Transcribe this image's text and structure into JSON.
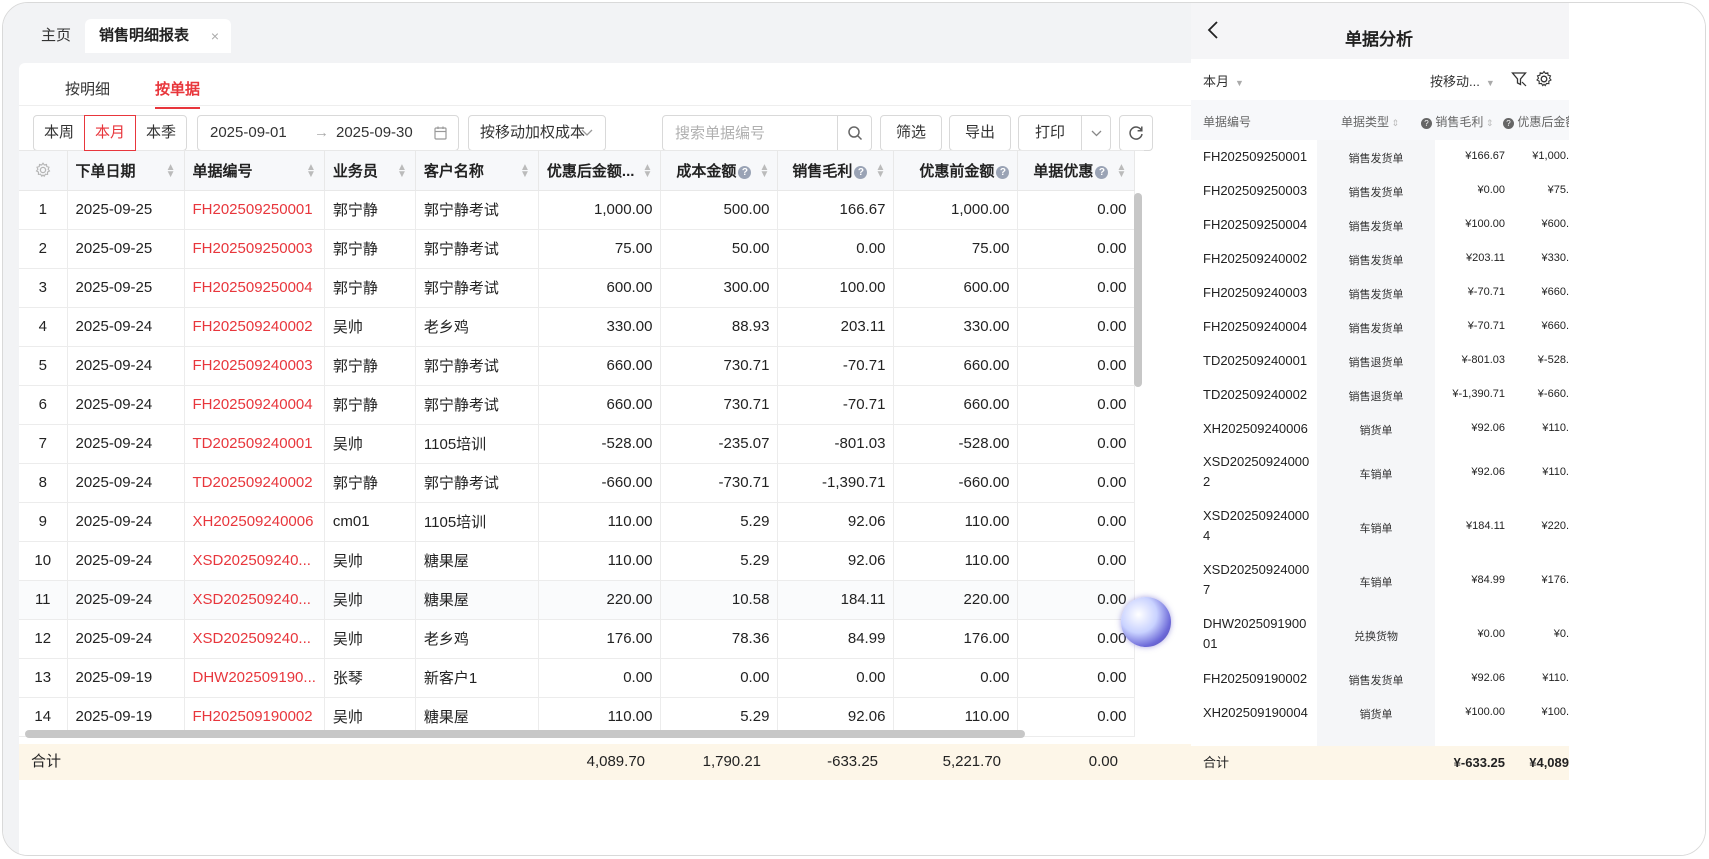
{
  "tabs": {
    "home": "主页",
    "active": "销售明细报表",
    "close": "×"
  },
  "subtabs": {
    "detail": "按明细",
    "document": "按单据"
  },
  "period": {
    "week": "本周",
    "month": "本月",
    "quarter": "本季"
  },
  "daterange": {
    "start": "2025-09-01",
    "arrow": "→",
    "end": "2025-09-30"
  },
  "cost_method": {
    "label": "按移动加权成本"
  },
  "search": {
    "placeholder": "搜索单据编号"
  },
  "buttons": {
    "filter": "筛选",
    "export": "导出",
    "print": "打印"
  },
  "table": {
    "headers": {
      "date": "下单日期",
      "docno": "单据编号",
      "salesman": "业务员",
      "customer": "客户名称",
      "after_discount": "优惠后金额...",
      "cost": "成本金额",
      "gross_profit": "销售毛利",
      "before_discount": "优惠前金额",
      "doc_discount": "单据优惠"
    },
    "rows": [
      {
        "idx": "1",
        "date": "2025-09-25",
        "docno": "FH202509250001",
        "salesman": "郭宁静",
        "customer": "郭宁静考试",
        "after": "1,000.00",
        "cost": "500.00",
        "profit": "166.67",
        "before": "1,000.00",
        "disc": "0.00"
      },
      {
        "idx": "2",
        "date": "2025-09-25",
        "docno": "FH202509250003",
        "salesman": "郭宁静",
        "customer": "郭宁静考试",
        "after": "75.00",
        "cost": "50.00",
        "profit": "0.00",
        "before": "75.00",
        "disc": "0.00"
      },
      {
        "idx": "3",
        "date": "2025-09-25",
        "docno": "FH202509250004",
        "salesman": "郭宁静",
        "customer": "郭宁静考试",
        "after": "600.00",
        "cost": "300.00",
        "profit": "100.00",
        "before": "600.00",
        "disc": "0.00"
      },
      {
        "idx": "4",
        "date": "2025-09-24",
        "docno": "FH202509240002",
        "salesman": "吴帅",
        "customer": "老乡鸡",
        "after": "330.00",
        "cost": "88.93",
        "profit": "203.11",
        "before": "330.00",
        "disc": "0.00"
      },
      {
        "idx": "5",
        "date": "2025-09-24",
        "docno": "FH202509240003",
        "salesman": "郭宁静",
        "customer": "郭宁静考试",
        "after": "660.00",
        "cost": "730.71",
        "profit": "-70.71",
        "before": "660.00",
        "disc": "0.00"
      },
      {
        "idx": "6",
        "date": "2025-09-24",
        "docno": "FH202509240004",
        "salesman": "郭宁静",
        "customer": "郭宁静考试",
        "after": "660.00",
        "cost": "730.71",
        "profit": "-70.71",
        "before": "660.00",
        "disc": "0.00"
      },
      {
        "idx": "7",
        "date": "2025-09-24",
        "docno": "TD202509240001",
        "salesman": "吴帅",
        "customer": "1105培训",
        "after": "-528.00",
        "cost": "-235.07",
        "profit": "-801.03",
        "before": "-528.00",
        "disc": "0.00"
      },
      {
        "idx": "8",
        "date": "2025-09-24",
        "docno": "TD202509240002",
        "salesman": "郭宁静",
        "customer": "郭宁静考试",
        "after": "-660.00",
        "cost": "-730.71",
        "profit": "-1,390.71",
        "before": "-660.00",
        "disc": "0.00"
      },
      {
        "idx": "9",
        "date": "2025-09-24",
        "docno": "XH202509240006",
        "salesman": "cm01",
        "customer": "1105培训",
        "after": "110.00",
        "cost": "5.29",
        "profit": "92.06",
        "before": "110.00",
        "disc": "0.00"
      },
      {
        "idx": "10",
        "date": "2025-09-24",
        "docno": "XSD202509240...",
        "salesman": "吴帅",
        "customer": "糖果屋",
        "after": "110.00",
        "cost": "5.29",
        "profit": "92.06",
        "before": "110.00",
        "disc": "0.00"
      },
      {
        "idx": "11",
        "date": "2025-09-24",
        "docno": "XSD202509240...",
        "salesman": "吴帅",
        "customer": "糖果屋",
        "after": "220.00",
        "cost": "10.58",
        "profit": "184.11",
        "before": "220.00",
        "disc": "0.00"
      },
      {
        "idx": "12",
        "date": "2025-09-24",
        "docno": "XSD202509240...",
        "salesman": "吴帅",
        "customer": "老乡鸡",
        "after": "176.00",
        "cost": "78.36",
        "profit": "84.99",
        "before": "176.00",
        "disc": "0.00"
      },
      {
        "idx": "13",
        "date": "2025-09-19",
        "docno": "DHW202509190...",
        "salesman": "张琴",
        "customer": "新客户1",
        "after": "0.00",
        "cost": "0.00",
        "profit": "0.00",
        "before": "0.00",
        "disc": "0.00"
      },
      {
        "idx": "14",
        "date": "2025-09-19",
        "docno": "FH202509190002",
        "salesman": "吴帅",
        "customer": "糖果屋",
        "after": "110.00",
        "cost": "5.29",
        "profit": "92.06",
        "before": "110.00",
        "disc": "0.00"
      }
    ],
    "total": {
      "label": "合计",
      "after": "4,089.70",
      "cost": "1,790.21",
      "profit": "-633.25",
      "before": "5,221.70",
      "disc": "0.00"
    }
  },
  "mobile": {
    "title": "单据分析",
    "month": "本月",
    "cost": "按移动...",
    "headers": {
      "docno": "单据编号",
      "type": "单据类型",
      "profit": "销售毛利",
      "after": "优惠后金额"
    },
    "rows": [
      {
        "docno": "FH202509250001",
        "type": "销售发货单",
        "profit": "¥166.67",
        "after": "¥1,000."
      },
      {
        "docno": "FH202509250003",
        "type": "销售发货单",
        "profit": "¥0.00",
        "after": "¥75."
      },
      {
        "docno": "FH202509250004",
        "type": "销售发货单",
        "profit": "¥100.00",
        "after": "¥600."
      },
      {
        "docno": "FH202509240002",
        "type": "销售发货单",
        "profit": "¥203.11",
        "after": "¥330."
      },
      {
        "docno": "FH202509240003",
        "type": "销售发货单",
        "profit": "¥-70.71",
        "after": "¥660."
      },
      {
        "docno": "FH202509240004",
        "type": "销售发货单",
        "profit": "¥-70.71",
        "after": "¥660."
      },
      {
        "docno": "TD202509240001",
        "type": "销售退货单",
        "profit": "¥-801.03",
        "after": "¥-528."
      },
      {
        "docno": "TD202509240002",
        "type": "销售退货单",
        "profit": "¥-1,390.71",
        "after": "¥-660."
      },
      {
        "docno": "XH202509240006",
        "type": "销货单",
        "profit": "¥92.06",
        "after": "¥110."
      },
      {
        "docno": "XSD20250924000",
        "docno2": "2",
        "type": "车销单",
        "profit": "¥92.06",
        "after": "¥110."
      },
      {
        "docno": "XSD20250924000",
        "docno2": "4",
        "type": "车销单",
        "profit": "¥184.11",
        "after": "¥220."
      },
      {
        "docno": "XSD20250924000",
        "docno2": "7",
        "type": "车销单",
        "profit": "¥84.99",
        "after": "¥176."
      },
      {
        "docno": "DHW2025091900",
        "docno2": "01",
        "type": "兑换货物",
        "profit": "¥0.00",
        "after": "¥0."
      },
      {
        "docno": "FH202509190002",
        "type": "销售发货单",
        "profit": "¥92.06",
        "after": "¥110."
      },
      {
        "docno": "XH202509190004",
        "type": "销货单",
        "profit": "¥100.00",
        "after": "¥100."
      }
    ],
    "total": {
      "label": "合计",
      "profit": "¥-633.25",
      "after": "¥4,089"
    }
  }
}
